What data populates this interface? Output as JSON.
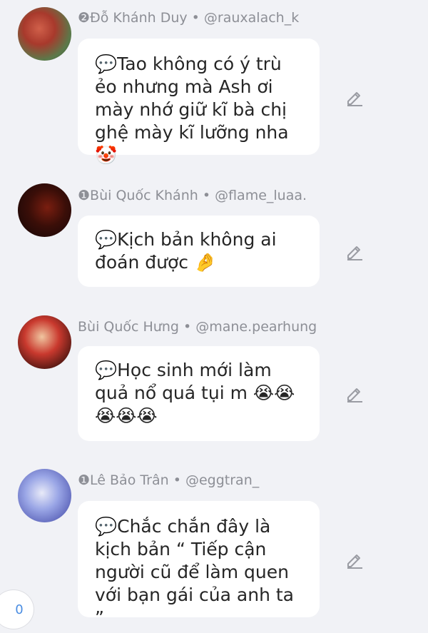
{
  "comments": [
    {
      "badge": "❷",
      "name": "Đỗ Khánh Duy",
      "handle": "@rauxalach_k",
      "text": "💬Tao không có ý trù ẻo nhưng mà Ash ơi mày nhớ giữ kĩ bà chị ghệ mày kĩ lưỡng nha 🤡",
      "edit_icon": "pencil-icon"
    },
    {
      "badge": "❶",
      "name": "Bùi Quốc Khánh",
      "handle": "@flame_luaa.",
      "text": "💬Kịch bản không ai đoán được 🤌",
      "edit_icon": "pencil-icon"
    },
    {
      "badge": "",
      "name": "Bùi Quốc Hưng",
      "handle": "@mane.pearhung",
      "text": "💬Học sinh mới làm quả nổ quá tụi m 😭😭 😭😭😭",
      "edit_icon": "pencil-icon"
    },
    {
      "badge": "❶",
      "name": "Lê Bảo Trân",
      "handle": "@eggtran_",
      "text": "💬Chắc chắn đây là kịch bản “ Tiếp cận người cũ để làm quen với bạn gái của anh ta ”",
      "edit_icon": "pencil-icon"
    }
  ],
  "separator": " • ",
  "reply_count": "0",
  "colors": {
    "background": "#f1f2f6",
    "bubble": "#ffffff",
    "meta_text": "#8d8f96",
    "accent": "#4a8de2"
  }
}
